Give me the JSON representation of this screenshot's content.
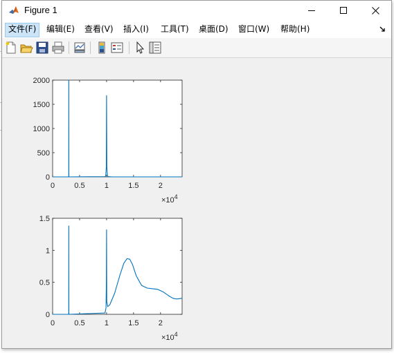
{
  "window": {
    "title": "Figure 1",
    "controls": [
      "minimize",
      "maximize",
      "close"
    ]
  },
  "menu": {
    "items": [
      {
        "label": "文件(F)"
      },
      {
        "label": "编辑(E)"
      },
      {
        "label": "查看(V)"
      },
      {
        "label": "插入(I)"
      },
      {
        "label": "工具(T)"
      },
      {
        "label": "桌面(D)"
      },
      {
        "label": "窗口(W)"
      },
      {
        "label": "帮助(H)"
      }
    ],
    "active_index": 0
  },
  "toolbar": {
    "buttons": [
      "new-figure-icon",
      "open-file-icon",
      "save-icon",
      "print-icon",
      "link-plot-icon",
      "insert-colorbar-icon",
      "insert-legend-icon",
      "edit-plot-icon",
      "property-inspector-icon"
    ]
  },
  "colors": {
    "line": "#0072bd",
    "axes_bg": "#ffffff",
    "figure_bg": "#f0f0f0"
  },
  "chart_data": [
    {
      "type": "line",
      "x_ticks": [
        "0",
        "0.5",
        "1",
        "1.5",
        "2"
      ],
      "y_ticks": [
        "0",
        "500",
        "1000",
        "1500",
        "2000"
      ],
      "x_exponent": {
        "base": "×10",
        "power": "4"
      },
      "xlim": [
        0,
        24000
      ],
      "ylim": [
        0,
        2000
      ],
      "series": [
        {
          "x": [
            0,
            2960,
            2990,
            3000,
            3010,
            3040,
            9700,
            9850,
            9950,
            10000,
            10050,
            10150,
            10300,
            11000,
            24000
          ],
          "y": [
            0,
            0,
            20,
            2000,
            20,
            0,
            5,
            25,
            200,
            1680,
            200,
            25,
            5,
            0,
            0
          ]
        }
      ]
    },
    {
      "type": "line",
      "x_ticks": [
        "0",
        "0.5",
        "1",
        "1.5",
        "2"
      ],
      "y_ticks": [
        "0",
        "0.5",
        "1",
        "1.5"
      ],
      "x_exponent": {
        "base": "×10",
        "power": "4"
      },
      "xlim": [
        0,
        24000
      ],
      "ylim": [
        0,
        1.5
      ],
      "series": [
        {
          "x": [
            0,
            2960,
            2990,
            3000,
            3010,
            3040,
            9700,
            9900,
            9960,
            10000,
            10030,
            10200,
            10600,
            11500,
            12500,
            13200,
            13800,
            14300,
            14800,
            15500,
            16500,
            17500,
            18500,
            19500,
            20500,
            21500,
            22300,
            23000,
            24000
          ],
          "y": [
            0,
            0,
            0.02,
            1.38,
            0.02,
            0,
            0.02,
            0.1,
            0.5,
            1.32,
            0.2,
            0.12,
            0.15,
            0.33,
            0.62,
            0.8,
            0.87,
            0.86,
            0.78,
            0.6,
            0.45,
            0.41,
            0.4,
            0.39,
            0.35,
            0.29,
            0.25,
            0.24,
            0.25
          ]
        }
      ]
    }
  ]
}
